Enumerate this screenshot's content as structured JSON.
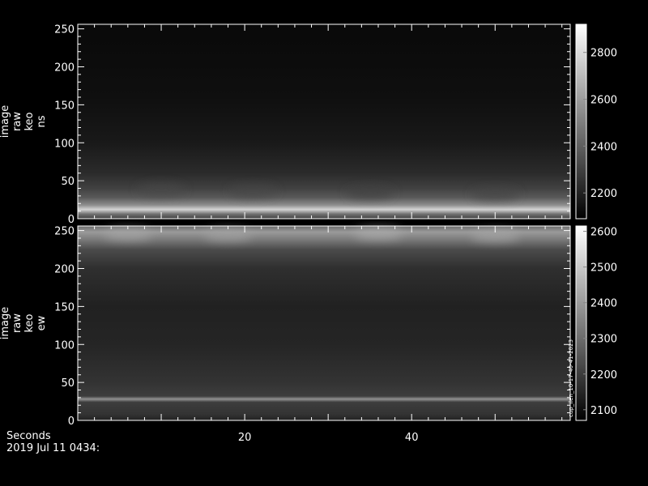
{
  "footer": {
    "time_label": "Seconds",
    "date_label": "2019 Jul 11 0434:"
  },
  "chart_data": [
    {
      "type": "heatmap",
      "ylabel_lines": [
        "image",
        "raw",
        "keo",
        "ns"
      ],
      "xlim": [
        0,
        59
      ],
      "ylim": [
        0,
        256
      ],
      "x_ticks": [
        20,
        40
      ],
      "y_ticks": [
        0,
        50,
        100,
        150,
        200,
        250
      ],
      "colorbar": {
        "ticks": [
          2200,
          2400,
          2600,
          2800
        ],
        "range": [
          2090,
          2920
        ]
      },
      "profile": [
        {
          "y": 0,
          "value": 2300
        },
        {
          "y": 6,
          "value": 2450
        },
        {
          "y": 12,
          "value": 2780
        },
        {
          "y": 18,
          "value": 2550
        },
        {
          "y": 28,
          "value": 2380
        },
        {
          "y": 40,
          "value": 2300
        },
        {
          "y": 60,
          "value": 2230
        },
        {
          "y": 100,
          "value": 2170
        },
        {
          "y": 160,
          "value": 2140
        },
        {
          "y": 256,
          "value": 2120
        }
      ],
      "patches": [
        {
          "x": 10,
          "y": 38,
          "value": 2330
        },
        {
          "x": 21,
          "y": 36,
          "value": 2320
        },
        {
          "x": 35,
          "y": 34,
          "value": 2300
        },
        {
          "x": 50,
          "y": 32,
          "value": 2310
        }
      ]
    },
    {
      "type": "heatmap",
      "ylabel_lines": [
        "image",
        "raw",
        "keo",
        "ew"
      ],
      "xlim": [
        0,
        59
      ],
      "ylim": [
        0,
        256
      ],
      "x_ticks": [
        20,
        40
      ],
      "y_ticks": [
        0,
        50,
        100,
        150,
        200,
        250
      ],
      "colorbar": {
        "ticks": [
          2100,
          2200,
          2300,
          2400,
          2500,
          2600
        ],
        "range": [
          2070,
          2615
        ],
        "side_label": "cup_ilen_10-17-40-41-2023"
      },
      "profile": [
        {
          "y": 0,
          "value": 2140
        },
        {
          "y": 8,
          "value": 2180
        },
        {
          "y": 24,
          "value": 2200
        },
        {
          "y": 28,
          "value": 2380
        },
        {
          "y": 32,
          "value": 2200
        },
        {
          "y": 50,
          "value": 2180
        },
        {
          "y": 100,
          "value": 2150
        },
        {
          "y": 150,
          "value": 2140
        },
        {
          "y": 200,
          "value": 2170
        },
        {
          "y": 225,
          "value": 2230
        },
        {
          "y": 238,
          "value": 2330
        },
        {
          "y": 248,
          "value": 2400
        },
        {
          "y": 256,
          "value": 2300
        }
      ],
      "patches": [
        {
          "x": 6,
          "y": 245,
          "value": 2430
        },
        {
          "x": 18,
          "y": 244,
          "value": 2420
        },
        {
          "x": 36,
          "y": 246,
          "value": 2440
        },
        {
          "x": 50,
          "y": 243,
          "value": 2430
        }
      ]
    }
  ]
}
